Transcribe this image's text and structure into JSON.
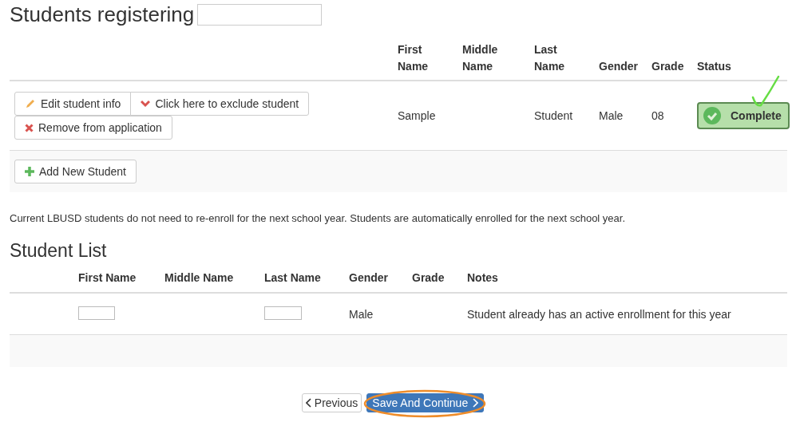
{
  "title": "Students registering",
  "registering": {
    "columns": [
      "First\nName",
      "Middle\nName",
      "Last\nName",
      "Gender",
      "Grade",
      "Status"
    ],
    "rows": [
      {
        "actions": [
          {
            "kind": "edit",
            "label": "Edit student info"
          },
          {
            "kind": "exclude",
            "label": "Click here to exclude student"
          },
          {
            "kind": "remove",
            "label": "Remove from application"
          }
        ],
        "first_name": "Sample",
        "last_name": "Student",
        "gender": "Male",
        "grade": "08",
        "status": {
          "label": "Complete",
          "complete": true
        }
      }
    ],
    "add_button": "Add New Student"
  },
  "note": "Current LBUSD students do not need to re-enroll for the next school year. Students are automatically enrolled for the next school year.",
  "list_title": "Student List",
  "student_list": {
    "columns": [
      "First Name",
      "Middle Name",
      "Last Name",
      "Gender",
      "Grade",
      "Notes"
    ],
    "rows": [
      {
        "first_redacted": true,
        "last_redacted": true,
        "gender": "Male",
        "notes": "Student already has an active enrollment for this year"
      }
    ]
  },
  "buttons": {
    "previous": "Previous",
    "save": "Save And Continue"
  }
}
